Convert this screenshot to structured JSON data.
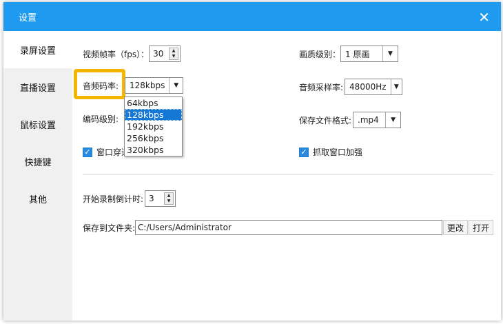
{
  "dialog": {
    "title": "设置",
    "close_icon": "close-icon"
  },
  "sidebar": {
    "items": [
      {
        "label": "录屏设置"
      },
      {
        "label": "直播设置"
      },
      {
        "label": "鼠标设置"
      },
      {
        "label": "快捷键"
      },
      {
        "label": "其他"
      }
    ]
  },
  "settings": {
    "fps_label": "视频帧率（fps）：",
    "fps_value": "30",
    "quality_label": "画质级别：",
    "quality_value": "1 原画",
    "audio_bitrate_label": "音频码率:",
    "audio_bitrate_value": "128kbps",
    "audio_bitrate_options": [
      "64kbps",
      "128kbps",
      "192kbps",
      "256kbps",
      "320kbps"
    ],
    "sample_rate_label": "音频采样率:",
    "sample_rate_value": "48000Hz",
    "encode_level_label": "编码级别:",
    "format_label": "保存文件格式:",
    "format_value": ".mp4",
    "window_through_label": "窗口穿透",
    "capture_enhance_label": "抓取窗口加强",
    "countdown_label": "开始录制倒计时:",
    "countdown_value": "3",
    "folder_label": "保存到文件夹:",
    "folder_value": "C:/Users/Administrator",
    "change_label": "更改",
    "open_label": "打开"
  },
  "colors": {
    "title_bar": "#1e9bf0",
    "highlight": "#f5b400",
    "selected": "#1577d6"
  }
}
